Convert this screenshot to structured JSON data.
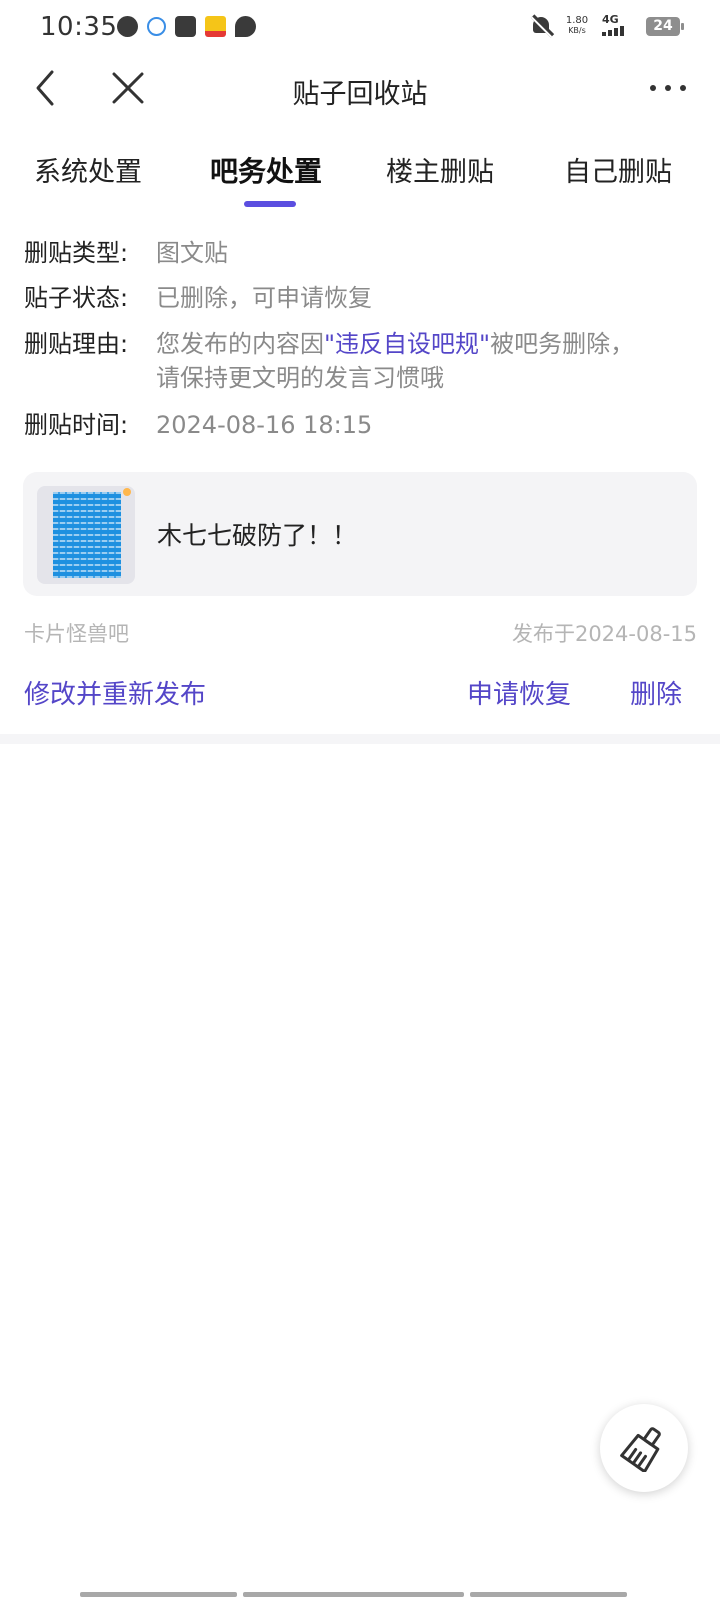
{
  "status_bar": {
    "time": "10:35",
    "net_speed_value": "1.80",
    "net_speed_unit": "KB/s",
    "network": "4G",
    "battery": "24",
    "notification_icons": [
      "wechat-icon",
      "cloud-icon",
      "shopping-bag-icon",
      "meituan-icon",
      "chat-bubble-icon"
    ]
  },
  "nav": {
    "title": "贴子回收站"
  },
  "tabs": [
    {
      "label": "系统处置",
      "active": false
    },
    {
      "label": "吧务处置",
      "active": true
    },
    {
      "label": "楼主删贴",
      "active": false
    },
    {
      "label": "自己删贴",
      "active": false
    }
  ],
  "details": {
    "type_label": "删贴类型:",
    "type_value": "图文贴",
    "status_label": "贴子状态:",
    "status_value": "已删除，可申请恢复",
    "reason_label": "删贴理由:",
    "reason_prefix": "您发布的内容因",
    "reason_link": "\"违反自设吧规\"",
    "reason_suffix": "被吧务删除，",
    "reason_line2": "请保持更文明的发言习惯哦",
    "time_label": "删贴时间:",
    "time_value": "2024-08-16 18:15"
  },
  "post": {
    "title": "木七七破防了！！",
    "forum": "卡片怪兽吧",
    "published": "发布于2024-08-15"
  },
  "actions": {
    "edit_republish": "修改并重新发布",
    "request_restore": "申请恢复",
    "delete": "删除"
  },
  "colors": {
    "accent": "#5446c8",
    "tab_indicator": "#5b4ee0",
    "muted_text": "#8a8a8a",
    "card_bg": "#f4f4f6"
  }
}
